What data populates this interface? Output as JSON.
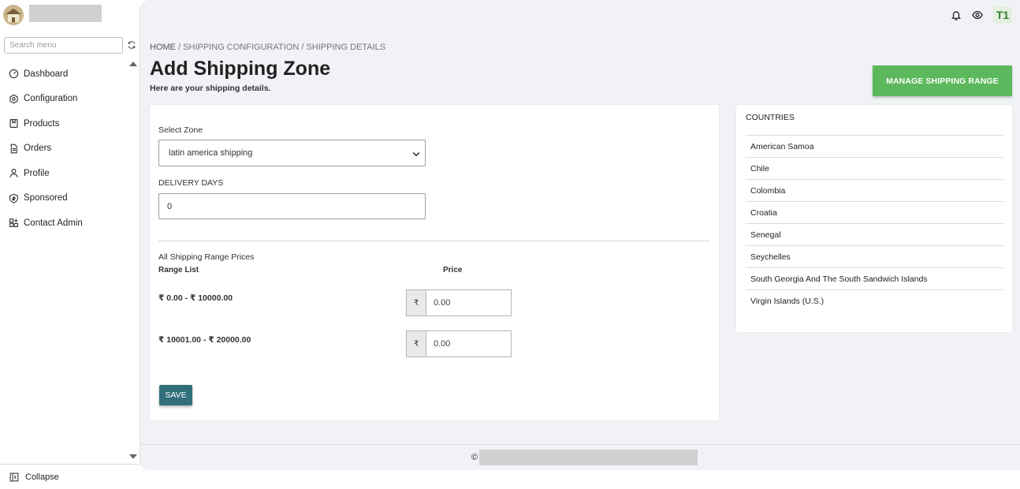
{
  "sidebar": {
    "search_placeholder": "Search menu",
    "items": [
      {
        "label": "Dashboard",
        "icon": "dashboard-icon"
      },
      {
        "label": "Configuration",
        "icon": "configuration-icon"
      },
      {
        "label": "Products",
        "icon": "products-icon"
      },
      {
        "label": "Orders",
        "icon": "orders-icon"
      },
      {
        "label": "Profile",
        "icon": "profile-icon"
      },
      {
        "label": "Sponsored",
        "icon": "sponsored-icon"
      },
      {
        "label": "Contact Admin",
        "icon": "contact-admin-icon"
      }
    ],
    "collapse_label": "Collapse"
  },
  "topbar": {
    "avatar_initials": "T1"
  },
  "breadcrumb": {
    "home": "HOME",
    "sep": "/",
    "level1": "SHIPPING CONFIGURATION",
    "level2": "SHIPPING DETAILS"
  },
  "page": {
    "title": "Add Shipping Zone",
    "subtitle": "Here are your shipping details.",
    "manage_button": "MANAGE SHIPPING RANGE"
  },
  "form": {
    "zone_label": "Select Zone",
    "zone_value": "latin america shipping",
    "delivery_label": "DELIVERY DAYS",
    "delivery_value": "0",
    "ranges_heading": "All Shipping Range Prices",
    "range_col": "Range List",
    "price_col": "Price",
    "currency_symbol": "₹",
    "ranges": [
      {
        "range": "₹ 0.00 - ₹ 10000.00",
        "price": "0.00"
      },
      {
        "range": "₹ 10001.00 - ₹ 20000.00",
        "price": "0.00"
      }
    ],
    "save_label": "SAVE"
  },
  "countries": {
    "title": "COUNTRIES",
    "items": [
      "American Samoa",
      "Chile",
      "Colombia",
      "Croatia",
      "Senegal",
      "Seychelles",
      "South Georgia And The South Sandwich Islands",
      "Virgin Islands (U.S.)"
    ]
  },
  "footer": {
    "copyright_symbol": "©"
  },
  "colors": {
    "manage_button": "#5cb85c",
    "save_button": "#31707a",
    "main_bg": "#f1f2f6"
  }
}
